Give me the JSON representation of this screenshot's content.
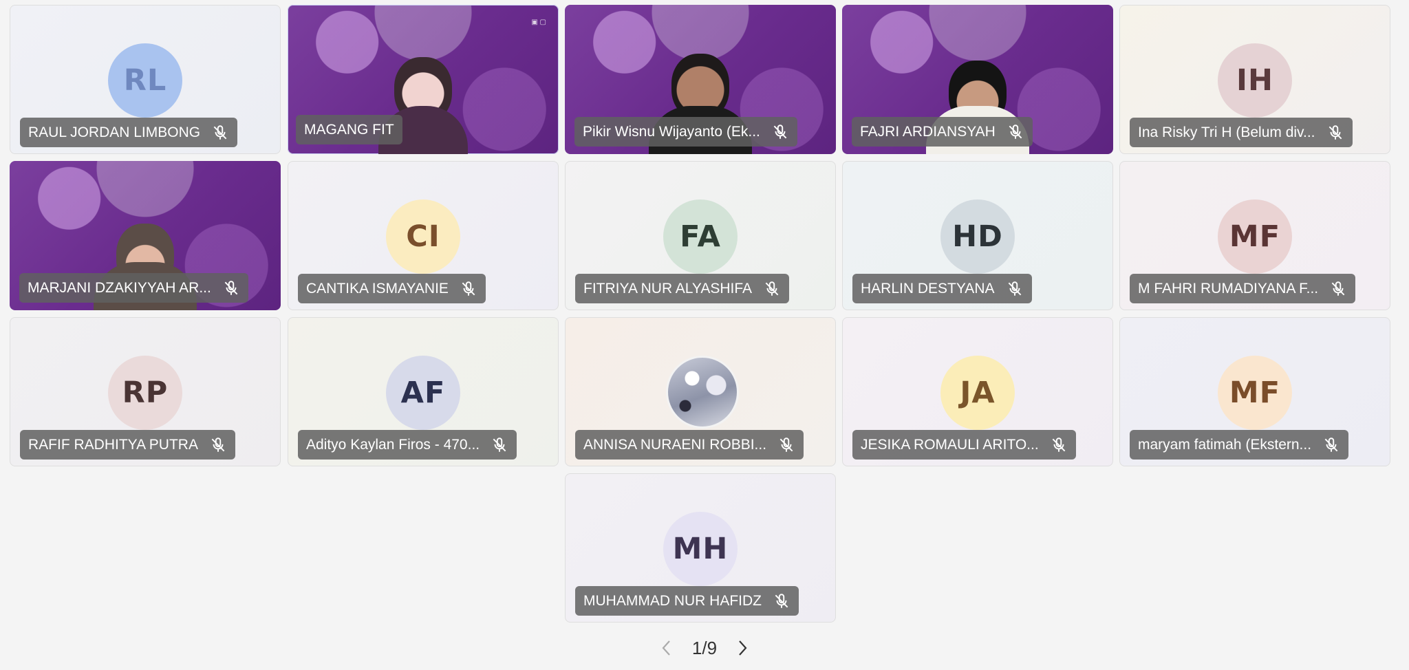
{
  "participants": [
    {
      "initials": "RL",
      "name": "RAUL JORDAN LIMBONG",
      "kind": "avatar",
      "avatar_bg": "#a9c3ef",
      "avatar_fg": "#6f88bf",
      "tile_bg": "#eef0f5"
    },
    {
      "initials": "",
      "name": "MAGANG FIT",
      "kind": "video",
      "active": true
    },
    {
      "initials": "",
      "name": "Pikir Wisnu Wijayanto (Ek...",
      "kind": "video"
    },
    {
      "initials": "",
      "name": "FAJRI ARDIANSYAH",
      "kind": "video"
    },
    {
      "initials": "IH",
      "name": "Ina Risky Tri H (Belum div...",
      "kind": "avatar",
      "avatar_bg": "#e5d2d4",
      "avatar_fg": "#5a3a3c",
      "tile_bg": "#f5f2ec"
    },
    {
      "initials": "",
      "name": "MARJANI DZAKIYYAH AR...",
      "kind": "video"
    },
    {
      "initials": "CI",
      "name": "CANTIKA ISMAYANIE",
      "kind": "avatar",
      "avatar_bg": "#fbecc0",
      "avatar_fg": "#7a4f2c",
      "tile_bg": "#f1f0f4"
    },
    {
      "initials": "FA",
      "name": "FITRIYA NUR ALYASHIFA",
      "kind": "avatar",
      "avatar_bg": "#d3e3d7",
      "avatar_fg": "#2e3e34",
      "tile_bg": "#f2f2f3"
    },
    {
      "initials": "HD",
      "name": "HARLIN DESTYANA",
      "kind": "avatar",
      "avatar_bg": "#d3dbe0",
      "avatar_fg": "#2c3338",
      "tile_bg": "#eef2f4"
    },
    {
      "initials": "MF",
      "name": "M FAHRI RUMADIYANA F...",
      "kind": "avatar",
      "avatar_bg": "#ead3d3",
      "avatar_fg": "#5a3434",
      "tile_bg": "#f4eff2"
    },
    {
      "initials": "RP",
      "name": "RAFIF RADHITYA PUTRA",
      "kind": "avatar",
      "avatar_bg": "#eadada",
      "avatar_fg": "#4a3434",
      "tile_bg": "#f1eff1"
    },
    {
      "initials": "AF",
      "name": "Adityo Kaylan Firos - 470...",
      "kind": "avatar",
      "avatar_bg": "#d7daea",
      "avatar_fg": "#2c3150",
      "tile_bg": "#f2f2ec"
    },
    {
      "initials": "",
      "name": "ANNISA NURAENI ROBBI...",
      "kind": "photo",
      "tile_bg": "#f5efea"
    },
    {
      "initials": "JA",
      "name": "JESIKA ROMAULI ARITO...",
      "kind": "avatar",
      "avatar_bg": "#fbedb8",
      "avatar_fg": "#7a552a",
      "tile_bg": "#f4eff3"
    },
    {
      "initials": "MF",
      "name": "maryam fatimah (Ekstern...",
      "kind": "avatar",
      "avatar_bg": "#fae6cf",
      "avatar_fg": "#7a4d2a",
      "tile_bg": "#efeff5"
    },
    {
      "initials": "MH",
      "name": "MUHAMMAD NUR HAFIDZ",
      "kind": "avatar",
      "avatar_bg": "#e5e2f3",
      "avatar_fg": "#3e3452",
      "tile_bg": "#f1eff3"
    }
  ],
  "pager": {
    "text": "1/9",
    "prev_icon": "chevron-left-icon",
    "next_icon": "chevron-right-icon"
  },
  "colors": {
    "active_border": "#5b63c9",
    "label_bg": "#606060",
    "video_purple": "#6a2c8e"
  }
}
